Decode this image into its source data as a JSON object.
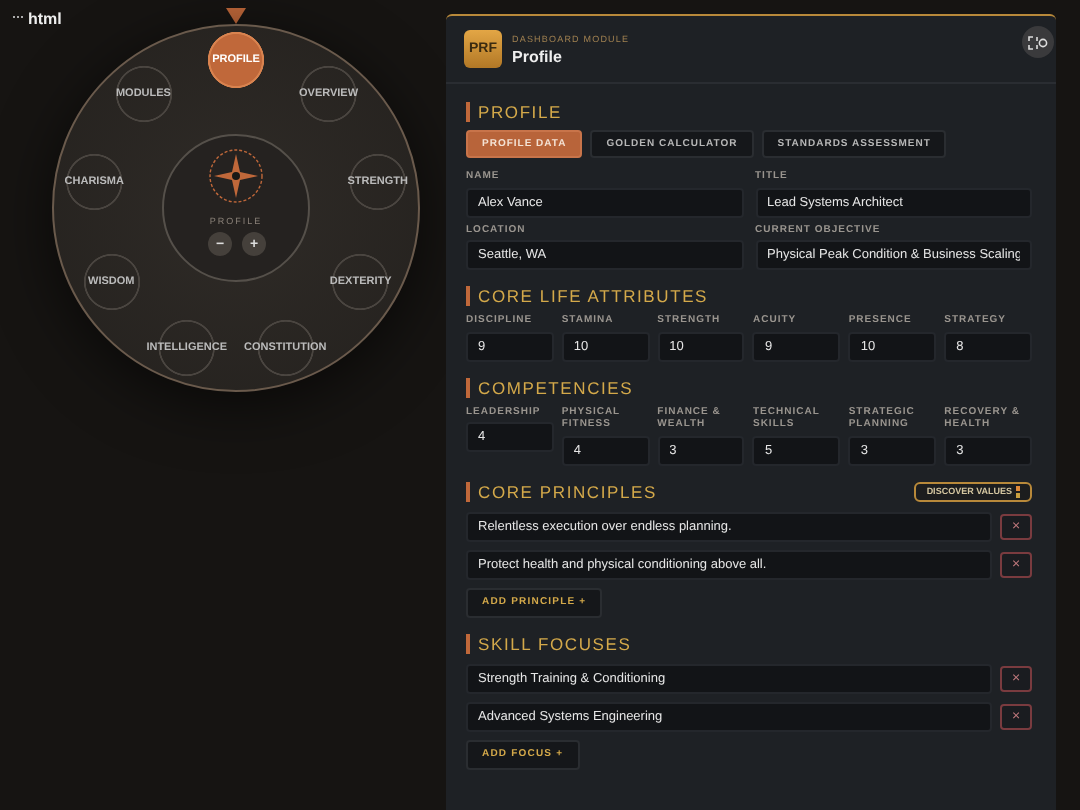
{
  "app_label": "html",
  "dial": {
    "nodes": [
      {
        "label": "PROFILE",
        "selected": true
      },
      {
        "label": "OVERVIEW",
        "selected": false
      },
      {
        "label": "STRENGTH",
        "selected": false
      },
      {
        "label": "DEXTERITY",
        "selected": false
      },
      {
        "label": "CONSTITUTION",
        "selected": false
      },
      {
        "label": "INTELLIGENCE",
        "selected": false
      },
      {
        "label": "WISDOM",
        "selected": false
      },
      {
        "label": "CHARISMA",
        "selected": false
      },
      {
        "label": "MODULES",
        "selected": false
      }
    ],
    "hub_label": "PROFILE",
    "zoom_out": "−",
    "zoom_in": "+"
  },
  "panel": {
    "badge": "PRF",
    "kicker": "DASHBOARD MODULE",
    "title": "Profile"
  },
  "profile": {
    "heading": "PROFILE",
    "tabs": [
      {
        "label": "PROFILE DATA",
        "selected": true
      },
      {
        "label": "GOLDEN CALCULATOR",
        "selected": false
      },
      {
        "label": "STANDARDS ASSESSMENT",
        "selected": false
      }
    ],
    "fields": [
      {
        "label": "NAME",
        "value": "Alex Vance"
      },
      {
        "label": "TITLE",
        "value": "Lead Systems Architect"
      },
      {
        "label": "LOCATION",
        "value": "Seattle, WA"
      },
      {
        "label": "CURRENT OBJECTIVE",
        "value": "Physical Peak Condition & Business Scaling"
      }
    ]
  },
  "attributes": {
    "heading": "CORE LIFE ATTRIBUTES",
    "fields": [
      {
        "label": "DISCIPLINE",
        "value": "9"
      },
      {
        "label": "STAMINA",
        "value": "10"
      },
      {
        "label": "STRENGTH",
        "value": "10"
      },
      {
        "label": "ACUITY",
        "value": "9"
      },
      {
        "label": "PRESENCE",
        "value": "10"
      },
      {
        "label": "STRATEGY",
        "value": "8"
      }
    ]
  },
  "competencies": {
    "heading": "COMPETENCIES",
    "fields": [
      {
        "label": "LEADERSHIP",
        "value": "4"
      },
      {
        "label": "PHYSICAL FITNESS",
        "value": "4"
      },
      {
        "label": "FINANCE & WEALTH",
        "value": "3"
      },
      {
        "label": "TECHNICAL SKILLS",
        "value": "5"
      },
      {
        "label": "STRATEGIC PLANNING",
        "value": "3"
      },
      {
        "label": "RECOVERY & HEALTH",
        "value": "3"
      }
    ]
  },
  "principles": {
    "heading": "CORE PRINCIPLES",
    "discover_button": "DISCOVER VALUES",
    "items": [
      {
        "value": "Relentless execution over endless planning.",
        "remove": "×"
      },
      {
        "value": "Protect health and physical conditioning above all.",
        "remove": "×"
      }
    ],
    "add_button": "ADD PRINCIPLE +"
  },
  "skills": {
    "heading": "SKILL FOCUSES",
    "items": [
      {
        "value": "Strength Training & Conditioning",
        "remove": "×"
      },
      {
        "value": "Advanced Systems Engineering",
        "remove": "×"
      }
    ],
    "add_button": "ADD FOCUS +"
  }
}
